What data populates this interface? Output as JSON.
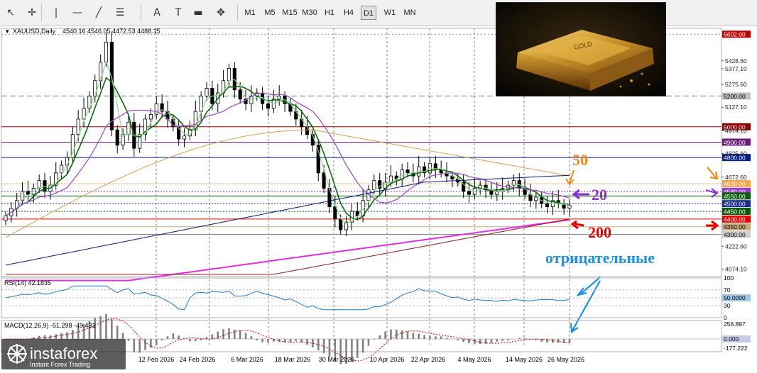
{
  "toolbar": {
    "tools": [
      {
        "name": "cursor-arrow-icon",
        "glyph": "↖"
      },
      {
        "name": "crosshair-icon",
        "glyph": "✛"
      },
      {
        "name": "vertical-line-icon",
        "glyph": "|"
      },
      {
        "name": "horizontal-line-icon",
        "glyph": "—"
      },
      {
        "name": "trendline-icon",
        "glyph": "╱"
      },
      {
        "name": "fibonacci-icon",
        "glyph": "☰"
      },
      {
        "name": "text-tool-icon",
        "glyph": "A"
      },
      {
        "name": "text-label-icon",
        "glyph": "T"
      },
      {
        "name": "rectangle-icon",
        "glyph": "▬"
      },
      {
        "name": "arrows-icon",
        "glyph": "✥"
      }
    ],
    "timeframes": [
      "M1",
      "M5",
      "M15",
      "M30",
      "H1",
      "H4",
      "D1",
      "W1",
      "MN"
    ],
    "active_timeframe": "D1"
  },
  "chart_data": {
    "type": "candlestick",
    "header": {
      "symbol": "XAUUSD,Daily",
      "ohlc": "4540.16 4546.05 4472.53 4488.15"
    },
    "yaxis_ticks": [
      "5377.10",
      "5428.60",
      "5275.60",
      "5127.10",
      "4974.10",
      "4825.60",
      "4672.60",
      "4222.60",
      "4074.10"
    ],
    "price_labels": [
      {
        "text": "5602.00",
        "value": 5602,
        "bg": "#c00000",
        "fg": "#ffffff",
        "line": "#888888",
        "dash": "2,3"
      },
      {
        "text": "5200.00",
        "value": 5200,
        "bg": "#c0c0c0",
        "fg": "#000000",
        "line": "#5a8a8a",
        "dash": "8,4"
      },
      {
        "text": "5000.00",
        "value": 5000,
        "bg": "#8b0000",
        "fg": "#ffffff",
        "line": "#8b0000",
        "dash": ""
      },
      {
        "text": "4900.00",
        "value": 4900,
        "bg": "#6a1b7a",
        "fg": "#ffffff",
        "line": "#6a1b7a",
        "dash": ""
      },
      {
        "text": "4800.00",
        "value": 4800,
        "bg": "#001a8a",
        "fg": "#ffffff",
        "line": "#001a8a",
        "dash": ""
      },
      {
        "text": "4630.00",
        "value": 4630,
        "bg": "#f4a64a",
        "fg": "#ffffff",
        "line": "#e8a23c",
        "dash": "2,2"
      },
      {
        "text": "4580.00",
        "value": 4580,
        "bg": "#9a3ad0",
        "fg": "#ffffff",
        "line": "#9a3ad0",
        "dash": "2,2"
      },
      {
        "text": "4550.00",
        "value": 4550,
        "bg": "#0a5a0a",
        "fg": "#ffffff",
        "line": "#0a5a0a",
        "dash": ""
      },
      {
        "text": "4500.00",
        "value": 4500,
        "bg": "#1e2a8a",
        "fg": "#ffffff",
        "line": "#1e2a8a",
        "dash": "2,2"
      },
      {
        "text": "4450.00",
        "value": 4450,
        "bg": "#0a5a0a",
        "fg": "#ffffff",
        "line": "#0a5a0a",
        "dash": "2,2"
      },
      {
        "text": "4400.00",
        "value": 4400,
        "bg": "#e00000",
        "fg": "#ffffff",
        "line": "#e00000",
        "dash": ""
      },
      {
        "text": "4350.00",
        "value": 4350,
        "bg": "#c8a87a",
        "fg": "#000000",
        "line": "#c8a87a",
        "dash": ""
      },
      {
        "text": "4300.00",
        "value": 4300,
        "bg": "#d0d0d0",
        "fg": "#000000",
        "line": "#888888",
        "dash": ""
      }
    ],
    "ylim": [
      4035,
      5640
    ],
    "x_dates": [
      "12 Feb 2026",
      "24 Feb 2026",
      "6 Mar 2026",
      "18 Mar 2026",
      "30 Mar 2026",
      "10 Apr 2026",
      "22 Apr 2026",
      "4 May 2026",
      "14 May 2026",
      "26 May 2026"
    ],
    "candles_close": [
      4420,
      4470,
      4520,
      4580,
      4560,
      4600,
      4650,
      4580,
      4620,
      4700,
      4750,
      4800,
      4950,
      5050,
      5120,
      5200,
      5300,
      5420,
      5550,
      4980,
      4880,
      4950,
      5030,
      4860,
      4950,
      5050,
      5080,
      5150,
      5100,
      5050,
      5000,
      4920,
      4940,
      4980,
      5100,
      5200,
      5250,
      5150,
      5220,
      5300,
      5380,
      5240,
      5180,
      5150,
      5200,
      5220,
      5150,
      5120,
      5180,
      5200,
      5150,
      5100,
      5050,
      5000,
      4950,
      4880,
      4700,
      4600,
      4480,
      4400,
      4330,
      4380,
      4450,
      4420,
      4520,
      4590,
      4650,
      4600,
      4640,
      4680,
      4660,
      4720,
      4700,
      4680,
      4740,
      4700,
      4760,
      4720,
      4700,
      4680,
      4660,
      4640,
      4580,
      4560,
      4600,
      4620,
      4590,
      4560,
      4580,
      4600,
      4620,
      4650,
      4600,
      4560,
      4520,
      4540,
      4500,
      4480,
      4520,
      4500,
      4470,
      4488
    ],
    "series": [
      {
        "name": "",
        "color": "#0a6a0a",
        "width": 1.6,
        "kind": "ma_fast"
      },
      {
        "name": "",
        "color": "#8fd48f",
        "width": 1.2,
        "kind": "ma_light"
      },
      {
        "name": "20",
        "color": "#a050c0",
        "width": 1.3,
        "kind": "ma20"
      },
      {
        "name": "50",
        "color": "#d4a050",
        "width": 1.0,
        "kind": "ma50"
      },
      {
        "name": "",
        "color": "#0a1a7a",
        "width": 1.0,
        "kind": "ma_blue"
      },
      {
        "name": "200",
        "color": "#e030e0",
        "width": 2.0,
        "kind": "ma200"
      },
      {
        "name": "",
        "color": "#8b1a1a",
        "width": 1.0,
        "kind": "ma_red"
      }
    ],
    "annotations": [
      {
        "text": "50",
        "color": "#f08a20"
      },
      {
        "text": "20",
        "color": "#8a30d0"
      },
      {
        "text": "200",
        "color": "#e00000"
      },
      {
        "text": "отрицательные",
        "color": "#1e90e0"
      }
    ],
    "rsi": {
      "label": "RSI(14) 42.1835",
      "ticks": [
        "100",
        "70",
        "50.0000",
        "30",
        "0"
      ],
      "ylim": [
        0,
        100
      ]
    },
    "macd": {
      "label": "MACD(12,26,9) -51.298 -49.431",
      "ticks": [
        "256.897",
        "0.000",
        "-177.222"
      ],
      "ylim": [
        -177.222,
        256.897
      ]
    },
    "image_text": "GOLD",
    "brand": {
      "name": "instaforex",
      "tagline": "Instant Forex Trading"
    }
  }
}
